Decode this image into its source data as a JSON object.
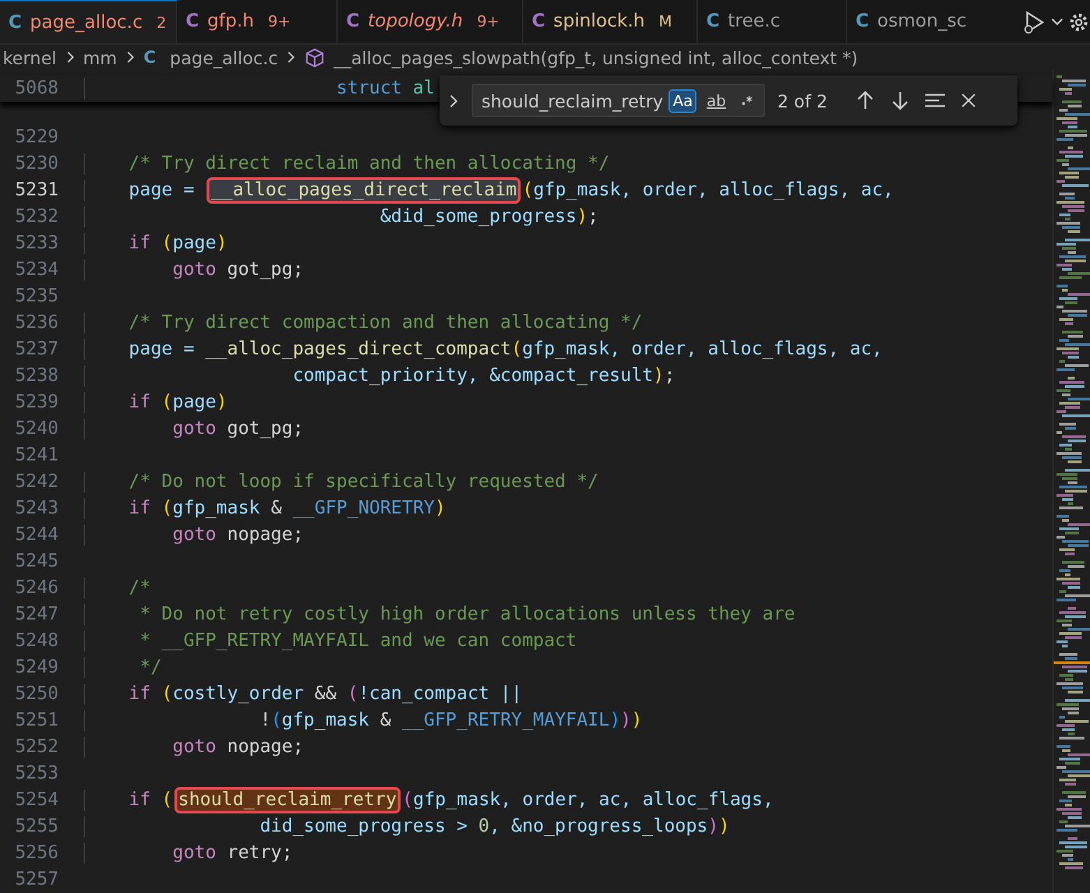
{
  "tabs": [
    {
      "icon": "C",
      "label": "page_alloc.c",
      "badge": "2",
      "kind": "error",
      "italic": false,
      "color": "#519aba",
      "selected": true
    },
    {
      "icon": "C",
      "label": "gfp.h",
      "badge": "9+",
      "kind": "error",
      "italic": false,
      "color": "#a074c4",
      "selected": false
    },
    {
      "icon": "C",
      "label": "topology.h",
      "badge": "9+",
      "kind": "error",
      "italic": true,
      "color": "#a074c4",
      "selected": false
    },
    {
      "icon": "C",
      "label": "spinlock.h",
      "badge": "M",
      "kind": "modified",
      "italic": false,
      "color": "#a074c4",
      "selected": false
    },
    {
      "icon": "C",
      "label": "tree.c",
      "kind": "plain",
      "italic": false,
      "color": "#519aba",
      "selected": false
    },
    {
      "icon": "C",
      "label": "osmon_sc",
      "kind": "plain",
      "italic": false,
      "color": "#519aba",
      "selected": false
    }
  ],
  "breadcrumbs": {
    "folders": [
      "kernel",
      "mm"
    ],
    "file_icon": "C",
    "file": "page_alloc.c",
    "symbol": "__alloc_pages_slowpath(gfp_t, unsigned int, alloc_context *)"
  },
  "sticky_line": {
    "number": "5068",
    "tokens": [
      {
        "text": "                       struct",
        "kind": "type"
      },
      {
        "text": " al",
        "kind": "class"
      }
    ]
  },
  "find": {
    "value": "should_reclaim_retry",
    "toggles": [
      {
        "kind": "text",
        "label": "Aa",
        "on": true
      },
      {
        "kind": "underlined",
        "label": "ab",
        "on": false
      },
      {
        "kind": "regex",
        "on": false
      }
    ],
    "count": "2 of 2"
  },
  "lines": [
    {
      "number": "5229",
      "current": false
    },
    {
      "number": "5230",
      "current": false,
      "tokens": [
        {
          "text": "    /* Try direct reclaim and then allocating */",
          "kind": "comment"
        }
      ]
    },
    {
      "number": "5231",
      "current": true,
      "tokens": [
        {
          "text": "    page = ",
          "kind": "var"
        },
        {
          "text": "__alloc_pages_direct_reclaim",
          "kind": "match",
          "selected": false
        },
        {
          "text": "(",
          "kind": "bracket"
        },
        {
          "text": "gfp_mask, order, alloc_flags, ac,",
          "kind": "var"
        }
      ]
    },
    {
      "number": "5232",
      "current": false,
      "tokens": [
        {
          "text": "                           &did_some_progress",
          "kind": "var"
        },
        {
          "text": ")",
          "kind": "bracket"
        },
        {
          "text": ";",
          "kind": "plain"
        }
      ]
    },
    {
      "number": "5233",
      "current": false,
      "tokens": [
        {
          "text": "    if ",
          "kind": "keyword"
        },
        {
          "text": "(",
          "kind": "bracket"
        },
        {
          "text": "page",
          "kind": "var"
        },
        {
          "text": ")",
          "kind": "bracket"
        }
      ]
    },
    {
      "number": "5234",
      "current": false,
      "tokens": [
        {
          "text": "        goto",
          "kind": "keyword"
        },
        {
          "text": " got_pg;",
          "kind": "plain"
        }
      ]
    },
    {
      "number": "5235",
      "current": false
    },
    {
      "number": "5236",
      "current": false,
      "tokens": [
        {
          "text": "    /* Try direct compaction and then allocating */",
          "kind": "comment"
        }
      ]
    },
    {
      "number": "5237",
      "current": false,
      "tokens": [
        {
          "text": "    page = ",
          "kind": "var"
        },
        {
          "text": "__alloc_pages_direct_compact",
          "kind": "func"
        },
        {
          "text": "(",
          "kind": "bracket"
        },
        {
          "text": "gfp_mask, order, alloc_flags, ac,",
          "kind": "var"
        }
      ]
    },
    {
      "number": "5238",
      "current": false,
      "tokens": [
        {
          "text": "                   compact_priority, &compact_result",
          "kind": "var"
        },
        {
          "text": ")",
          "kind": "bracket"
        },
        {
          "text": ";",
          "kind": "plain"
        }
      ]
    },
    {
      "number": "5239",
      "current": false,
      "tokens": [
        {
          "text": "    if ",
          "kind": "keyword"
        },
        {
          "text": "(",
          "kind": "bracket"
        },
        {
          "text": "page",
          "kind": "var"
        },
        {
          "text": ")",
          "kind": "bracket"
        }
      ]
    },
    {
      "number": "5240",
      "current": false,
      "tokens": [
        {
          "text": "        goto",
          "kind": "keyword"
        },
        {
          "text": " got_pg;",
          "kind": "plain"
        }
      ]
    },
    {
      "number": "5241",
      "current": false
    },
    {
      "number": "5242",
      "current": false,
      "tokens": [
        {
          "text": "    /* Do not loop if specifically requested */",
          "kind": "comment"
        }
      ]
    },
    {
      "number": "5243",
      "current": false,
      "tokens": [
        {
          "text": "    if ",
          "kind": "keyword"
        },
        {
          "text": "(",
          "kind": "bracket"
        },
        {
          "text": "gfp_mask",
          "kind": "var"
        },
        {
          "text": " & ",
          "kind": "plain"
        },
        {
          "text": "__GFP_NORETRY",
          "kind": "macro"
        },
        {
          "text": ")",
          "kind": "bracket"
        }
      ]
    },
    {
      "number": "5244",
      "current": false,
      "tokens": [
        {
          "text": "        goto",
          "kind": "keyword"
        },
        {
          "text": " nopage;",
          "kind": "plain"
        }
      ]
    },
    {
      "number": "5245",
      "current": false
    },
    {
      "number": "5246",
      "current": false,
      "tokens": [
        {
          "text": "    /*",
          "kind": "comment"
        }
      ]
    },
    {
      "number": "5247",
      "current": false,
      "tokens": [
        {
          "text": "     * Do not retry costly high order allocations unless they are",
          "kind": "comment"
        }
      ]
    },
    {
      "number": "5248",
      "current": false,
      "tokens": [
        {
          "text": "     * __GFP_RETRY_MAYFAIL and we can compact",
          "kind": "comment"
        }
      ]
    },
    {
      "number": "5249",
      "current": false,
      "tokens": [
        {
          "text": "     */",
          "kind": "comment"
        }
      ]
    },
    {
      "number": "5250",
      "current": false,
      "tokens": [
        {
          "text": "    if ",
          "kind": "keyword"
        },
        {
          "text": "(",
          "kind": "bracket"
        },
        {
          "text": "costly_order",
          "kind": "var"
        },
        {
          "text": " && ",
          "kind": "plain"
        },
        {
          "text": "(",
          "kind": "bracket2"
        },
        {
          "text": "!can_compact ||",
          "kind": "var"
        }
      ]
    },
    {
      "number": "5251",
      "current": false,
      "tokens": [
        {
          "text": "                !",
          "kind": "plain"
        },
        {
          "text": "(",
          "kind": "bracket3"
        },
        {
          "text": "gfp_mask",
          "kind": "var"
        },
        {
          "text": " & ",
          "kind": "plain"
        },
        {
          "text": "__GFP_RETRY_MAYFAIL",
          "kind": "macro"
        },
        {
          "text": ")",
          "kind": "bracket3"
        },
        {
          "text": ")",
          "kind": "bracket2"
        },
        {
          "text": ")",
          "kind": "bracket"
        }
      ]
    },
    {
      "number": "5252",
      "current": false,
      "tokens": [
        {
          "text": "        goto",
          "kind": "keyword"
        },
        {
          "text": " nopage;",
          "kind": "plain"
        }
      ]
    },
    {
      "number": "5253",
      "current": false
    },
    {
      "number": "5254",
      "current": false,
      "tokens": [
        {
          "text": "    if ",
          "kind": "keyword"
        },
        {
          "text": "(",
          "kind": "bracket"
        },
        {
          "text": "should_reclaim_retry",
          "kind": "match",
          "selected": true
        },
        {
          "text": "(",
          "kind": "bracket2"
        },
        {
          "text": "gfp_mask, order, ac, alloc_flags,",
          "kind": "var"
        }
      ]
    },
    {
      "number": "5255",
      "current": false,
      "tokens": [
        {
          "text": "                did_some_progress > ",
          "kind": "var"
        },
        {
          "text": "0",
          "kind": "number"
        },
        {
          "text": ", &no_progress_loops",
          "kind": "var"
        },
        {
          "text": ")",
          "kind": "bracket2"
        },
        {
          "text": ")",
          "kind": "bracket"
        }
      ]
    },
    {
      "number": "5256",
      "current": false,
      "tokens": [
        {
          "text": "        goto",
          "kind": "keyword"
        },
        {
          "text": " retry;",
          "kind": "plain"
        }
      ]
    },
    {
      "number": "5257",
      "current": false
    }
  ]
}
